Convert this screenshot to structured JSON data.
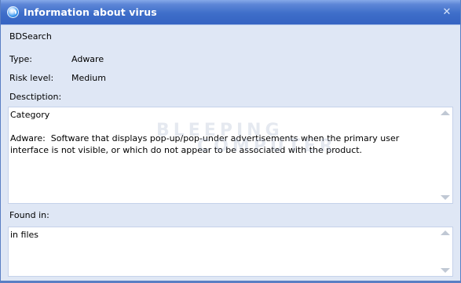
{
  "window": {
    "title": "Information about virus",
    "close_glyph": "✕"
  },
  "virus": {
    "name": "BDSearch",
    "type_label": "Type:",
    "type_value": "Adware",
    "risk_label": "Risk level:",
    "risk_value": "Medium",
    "description_label": "Desctiption:",
    "description": {
      "heading": "Category",
      "body": "Adware:  Software that displays pop-up/pop-under advertisements when the primary user interface is not visible, or which do not appear to be associated with the product."
    },
    "found_label": "Found in:",
    "found_value": "in files"
  },
  "watermark": {
    "line1": "BLEEPING",
    "line2": "COMPUTER"
  },
  "icons": {
    "app": "virus-info-icon",
    "close": "close-icon"
  }
}
